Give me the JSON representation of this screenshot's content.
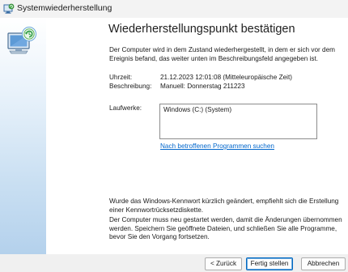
{
  "window": {
    "title": "Systemwiederherstellung"
  },
  "page": {
    "heading": "Wiederherstellungspunkt bestätigen",
    "intro": "Der Computer wird in dem Zustand wiederhergestellt, in dem er sich vor dem Ereignis befand, das weiter unten im Beschreibungsfeld angegeben ist."
  },
  "details": {
    "time_label": "Uhrzeit:",
    "time_value": "21.12.2023 12:01:08 (Mitteleuropäische Zeit)",
    "description_label": "Beschreibung:",
    "description_value": "Manuell: Donnerstag 211223",
    "drives_label": "Laufwerke:",
    "drives": [
      "Windows (C:) (System)"
    ]
  },
  "link": {
    "affected_programs": "Nach betroffenen Programmen suchen"
  },
  "notes": {
    "password": "Wurde das Windows-Kennwort kürzlich geändert, empfiehlt sich die Erstellung einer Kennwortrücksetzdiskette.",
    "restart": "Der Computer muss neu gestartet werden, damit die Änderungen übernommen werden. Speichern Sie geöffnete Dateien, und schließen Sie alle Programme, bevor Sie den Vorgang fortsetzen."
  },
  "buttons": {
    "back": "< Zurück",
    "finish": "Fertig stellen",
    "cancel": "Abbrechen"
  },
  "icons": {
    "title": "system-restore-icon",
    "sidebar": "system-restore-graphic"
  },
  "colors": {
    "link": "#0066cc",
    "default_button_border": "#0067c0",
    "sidebar_gradient_end": "#b4d1ec"
  }
}
